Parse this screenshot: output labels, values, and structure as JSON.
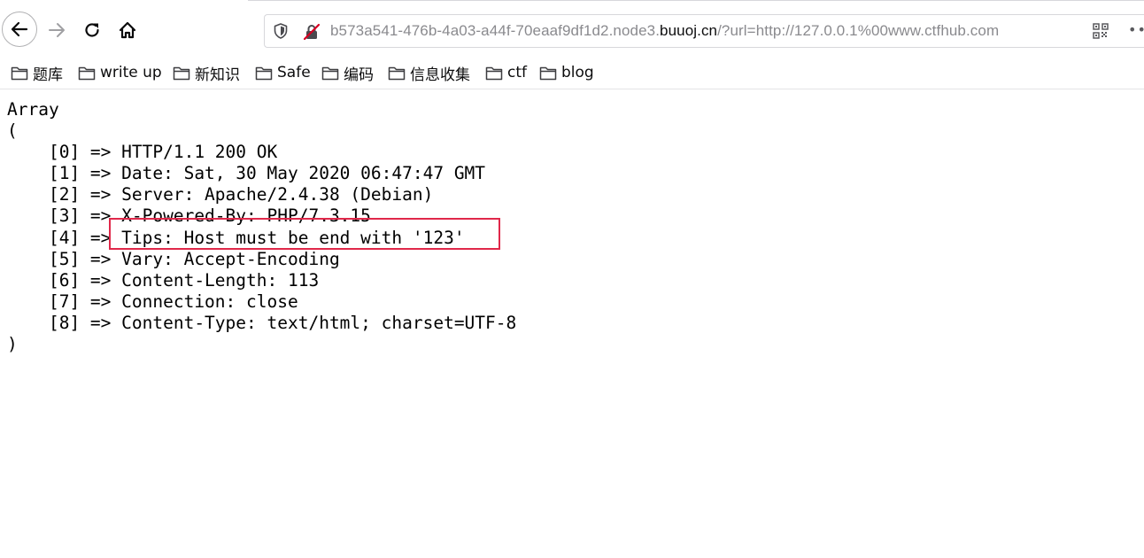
{
  "browser": {
    "url": {
      "prefix": "b573a541-476b-4a03-a44f-70eaaf9df1d2.node3.",
      "host": "buuoj.cn",
      "suffix": "/?url=http://127.0.0.1%00www.ctfhub.com"
    },
    "icons": {
      "back": "back-arrow-icon",
      "forward": "forward-arrow-icon",
      "reload": "reload-icon",
      "home": "home-icon",
      "shield": "shield-icon",
      "insecure": "insecure-lock-icon",
      "qr": "qr-code-icon",
      "more": "more-icon"
    },
    "more_label": "•••"
  },
  "bookmarks": [
    {
      "label": "题库"
    },
    {
      "label": "write up"
    },
    {
      "label": "新知识"
    },
    {
      "label": "Safe"
    },
    {
      "label": "编码"
    },
    {
      "label": "信息收集"
    },
    {
      "label": "ctf"
    },
    {
      "label": "blog"
    }
  ],
  "output": {
    "lines": [
      "Array",
      "(",
      "    [0] => HTTP/1.1 200 OK",
      "    [1] => Date: Sat, 30 May 2020 06:47:47 GMT",
      "    [2] => Server: Apache/2.4.38 (Debian)",
      "    [3] => X-Powered-By: PHP/7.3.15",
      "    [4] => Tips: Host must be end with '123'",
      "    [5] => Vary: Accept-Encoding",
      "    [6] => Content-Length: 113",
      "    [7] => Connection: close",
      "    [8] => Content-Type: text/html; charset=UTF-8",
      ")"
    ]
  },
  "colors": {
    "highlight_box": "#e0284a",
    "insecure_strike": "#d70022"
  }
}
